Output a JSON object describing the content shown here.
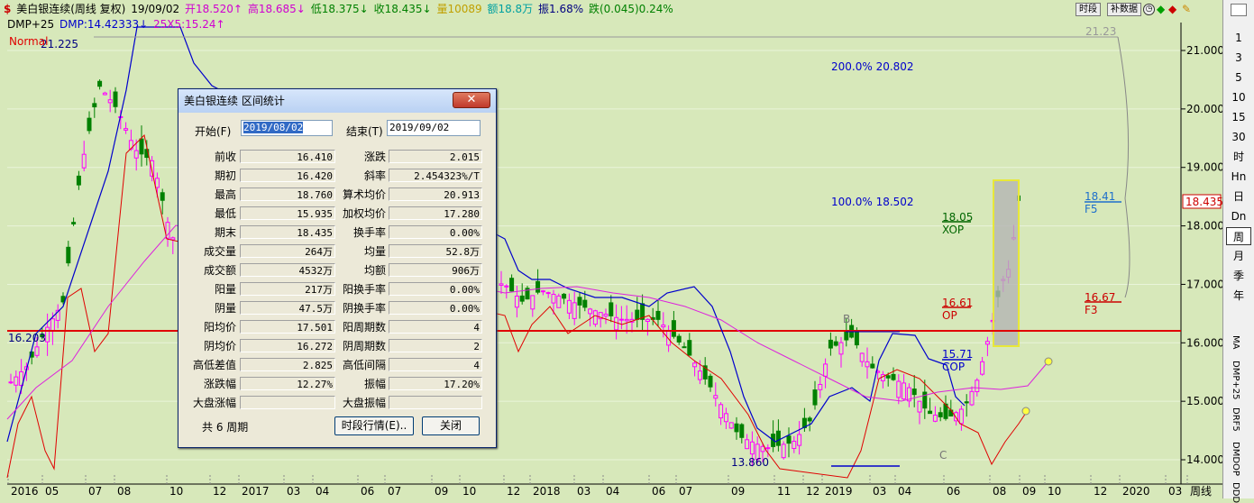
{
  "header": {
    "dollar_icon": "dollar-icon",
    "title": "美白银连续(周线 复权)",
    "date": "19/09/02",
    "open": "开18.520↑",
    "high": "高18.685↓",
    "low": "低18.375↓",
    "close": "收18.435↓",
    "volume": "量10089",
    "amount": "额18.8万",
    "amplitude": "振1.68%",
    "change": "跌(0.045)0.24%",
    "indicator": "DMP+25",
    "dmp": "DMP:14.42333↓",
    "ma": "25X5:15.24↑",
    "normal_label": "Normal"
  },
  "toolbar": {
    "period_btn": "时段",
    "supplement_btn": "补数据"
  },
  "right_panel": {
    "items": [
      "1",
      "3",
      "5",
      "10",
      "15",
      "30",
      "时",
      "Hn",
      "日",
      "Dn",
      "周",
      "月",
      "季",
      "年"
    ],
    "selected": "周",
    "vertical_tabs": [
      "MA",
      "DMP+25",
      "DRF5",
      "DMDOP",
      "DDD"
    ]
  },
  "colors": {
    "bg": "#d7e8ba",
    "grid": "#e6f2d3",
    "up": "#ff00ff",
    "down": "#008000",
    "red_line": "#e00000",
    "blue_line": "#0000cc",
    "pink_line": "#dd22dd",
    "accent": "#316ac5"
  },
  "chart_annotations": {
    "fib_200": "200.0% 20.802",
    "fib_100": "100.0% 18.502",
    "xop_val": "18.05",
    "xop": "XOP",
    "op_val": "16.61",
    "op": "OP",
    "cop_val": "15.71",
    "cop": "COP",
    "f5_val": "18.41",
    "f5": "F5",
    "f3_val": "16.67",
    "f3": "F3",
    "top_label": "21.23",
    "high_label": "21.225",
    "low_label": "13.860",
    "left_level": "16.203",
    "price_tag": "18.435",
    "b_label": "B",
    "c_label": "C"
  },
  "y_axis": [
    "21.000",
    "20.000",
    "19.000",
    "18.000",
    "17.000",
    "16.000",
    "15.000",
    "14.000"
  ],
  "x_axis": [
    "2016",
    "05",
    "07",
    "08",
    "10",
    "12",
    "2017",
    "03",
    "04",
    "06",
    "07",
    "09",
    "10",
    "12",
    "2018",
    "03",
    "04",
    "06",
    "07",
    "09",
    "11",
    "12",
    "2019",
    "03",
    "04",
    "06",
    "08",
    "09",
    "10",
    "12",
    "2020",
    "03",
    "周线"
  ],
  "dialog": {
    "title": "美白银连续 区间统计",
    "start_label": "开始(F)",
    "start_value": "2019/08/02",
    "end_label": "结束(T)",
    "end_value": "2019/09/02",
    "rows": [
      {
        "l1": "前收",
        "v1": "16.410",
        "l2": "涨跌",
        "v2": "2.015"
      },
      {
        "l1": "期初",
        "v1": "16.420",
        "l2": "斜率",
        "v2": "2.454323%/T"
      },
      {
        "l1": "最高",
        "v1": "18.760",
        "l2": "算术均价",
        "v2": "20.913"
      },
      {
        "l1": "最低",
        "v1": "15.935",
        "l2": "加权均价",
        "v2": "17.280"
      },
      {
        "l1": "期末",
        "v1": "18.435",
        "l2": "换手率",
        "v2": "0.00%"
      },
      {
        "l1": "成交量",
        "v1": "264万",
        "l2": "均量",
        "v2": "52.8万"
      },
      {
        "l1": "成交额",
        "v1": "4532万",
        "l2": "均额",
        "v2": "906万"
      },
      {
        "l1": "阳量",
        "v1": "217万",
        "l2": "阳换手率",
        "v2": "0.00%"
      },
      {
        "l1": "阴量",
        "v1": "47.5万",
        "l2": "阴换手率",
        "v2": "0.00%"
      },
      {
        "l1": "阳均价",
        "v1": "17.501",
        "l2": "阳周期数",
        "v2": "4"
      },
      {
        "l1": "阴均价",
        "v1": "16.272",
        "l2": "阴周期数",
        "v2": "2"
      },
      {
        "l1": "高低差值",
        "v1": "2.825",
        "l2": "高低间隔",
        "v2": "4"
      },
      {
        "l1": "涨跌幅",
        "v1": "12.27%",
        "l2": "振幅",
        "v2": "17.20%"
      },
      {
        "l1": "大盘涨幅",
        "v1": "",
        "l2": "大盘振幅",
        "v2": ""
      }
    ],
    "period_count": "共 6 周期",
    "btn_market": "时段行情(E)..",
    "btn_close": "关闭",
    "close_x": "✕"
  }
}
